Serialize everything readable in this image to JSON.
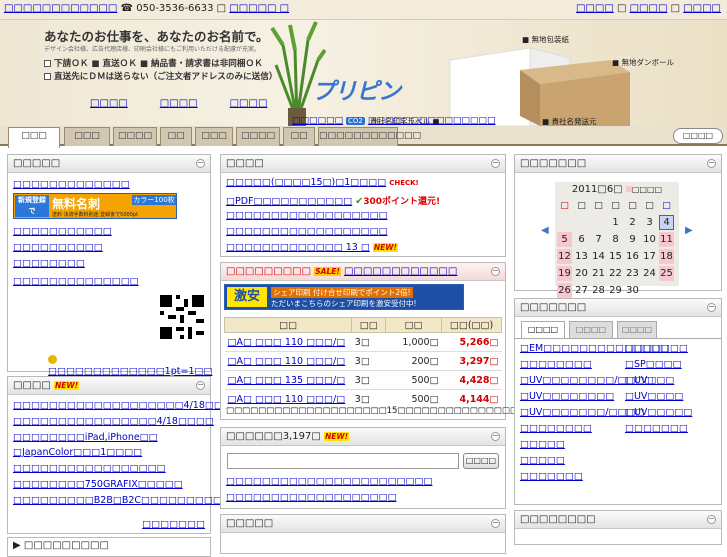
{
  "topbar": {
    "left_text": "□□□□□□□□□□□□",
    "phone": "050-3536-6633 □",
    "phone_suffix": "□□□□□ □",
    "right_links": [
      "□□□□",
      "□□□□",
      "□□□□"
    ]
  },
  "hero": {
    "headline": "あなたのお仕事を、あなたのお名前で。",
    "sub": "デザイン会社様、広告代理店様、印刷会社様にもご利用いただける配慮が充実。",
    "features": [
      "下請ＯＫ ■ 直送ＯＫ ■ 納品書・請求書は非同梱ＯＫ",
      "直送先にＤＭは送らない（ご注文者アドレスのみに送信）"
    ],
    "links": [
      "□□□□",
      "□□□□",
      "□□□□"
    ],
    "logo": "プリピン",
    "eco_left": "□□□□□□",
    "eco_badge": "CO2",
    "eco_right": "□□□□□□□□□□□□□□□",
    "labels": [
      "無地包装紙",
      "無地ダンボール",
      "貴社名印字ラベル",
      "貴社名発送元"
    ]
  },
  "tabs": [
    "□□□",
    "□□□",
    "□□□□",
    "□□",
    "□□□",
    "□□□□",
    "□□",
    "□□□□□□□□□□□□"
  ],
  "search_tab": "□□□□",
  "left1": {
    "title": "□□□□□",
    "items": [
      "□□□□□□□□□□□□□",
      "□□□□□□□□□□□",
      "□□□□□□□□□□",
      "□□□□□□□□",
      "□□□□□□□□□□□□□□"
    ],
    "banner_left": "新規登録で",
    "banner_mid": "無料名刺",
    "banner_right": "カラー100枚",
    "banner_sub": "送料 決済手数料別途 登録後で5000pt",
    "footer": "□□□□□□□□□□□□□1pt=1□□"
  },
  "left2": {
    "title": "□□□□",
    "items": [
      "□□□□□□□□□□□□□□□□□□□4/18□□□",
      "□□□□□□□□□□□□□□□□4/18□□□□",
      "□□□□□□□□iPad,iPhone□□",
      "□JapanColor□□□1□□□□",
      "□□□□□□□□□□□□□□□□□",
      "□□□□□□□□750GRAFIX□□□□□",
      "□□□□□□□□□B2B□B2C□□□□□□□□□□"
    ],
    "more": "□□□□□□□",
    "new": "NEW!"
  },
  "left3": {
    "title": "□□□□□□□□□"
  },
  "mid1": {
    "title": "□□□□",
    "items": [
      "□□□□□(□□□□15□)□1□□□□",
      "□PDF□□□□□□□□□□□",
      "□□□□□□□□□□□□□□□□□□",
      "□□□□□□□□□□□□□□□□□□",
      "□□□□□□□□□□□□□ 13 □"
    ],
    "check": "CHECK!",
    "points": "300ポイント還元!",
    "new": "NEW!"
  },
  "mid2": {
    "title_left": "□□□□□□□□□",
    "sale": "SALE!",
    "title_right": "□□□□□□□□□□□□",
    "banner_big": "激安",
    "banner_line1": "シェア印刷 付け合せ印刷でポイント2倍!",
    "banner_line2": "ただいまこちらのシェア印刷を激安受付中!",
    "headers": [
      "□□",
      "□□",
      "□□",
      "□□(□□)"
    ],
    "rows": [
      [
        "□A□ □□□ 110 □□□/□",
        "3□",
        "1,000□",
        "5,266□"
      ],
      [
        "□A□ □□□ 110 □□□/□",
        "3□",
        "200□",
        "3,297□"
      ],
      [
        "□A□ □□□ 135 □□□/□",
        "3□",
        "500□",
        "4,428□"
      ],
      [
        "□A□ □□□ 110 □□□/□",
        "3□",
        "500□",
        "4,144□"
      ]
    ],
    "footnote": "□□□□□□□□□□□□□□□□□□□□15□□□□□□□□□□□□□□□"
  },
  "mid3": {
    "title": "□□□□□□3,197□",
    "new": "NEW!",
    "search_button": "□□□□",
    "links": [
      "□□□□□□□□□□□□□□□□□□□□□□□",
      "□□□□□□□□□□□□□□□□□□□"
    ]
  },
  "mid4": {
    "title": "□□□□□"
  },
  "cal": {
    "title": "□□□□□□□",
    "header": "2011□6□",
    "legend": "□□□□",
    "weekdays": [
      "□",
      "□",
      "□",
      "□",
      "□",
      "□",
      "□"
    ],
    "weeks": [
      [
        "",
        "",
        "",
        "1",
        "2",
        "3",
        "4"
      ],
      [
        "5",
        "6",
        "7",
        "8",
        "9",
        "10",
        "11"
      ],
      [
        "12",
        "13",
        "14",
        "15",
        "16",
        "17",
        "18"
      ],
      [
        "19",
        "20",
        "21",
        "22",
        "23",
        "24",
        "25"
      ],
      [
        "26",
        "27",
        "28",
        "29",
        "30",
        "",
        ""
      ]
    ]
  },
  "right2": {
    "title": "□□□□□□□",
    "subtabs": [
      "□□□□",
      "□□□□",
      "□□□□"
    ],
    "left_items": [
      "□EM□□□□□□□□□□□□□□",
      "□□□□□□□□",
      "□UV□□□□□□□□/□□□□",
      "□UV□□□□□□□□",
      "□UV□□□□□□□/□□□□",
      "□□□□□□□□",
      "□□□□□",
      "□□□□□",
      "□□□□□□□"
    ],
    "right_items": [
      "□□□□□□□",
      "□SP□□□□",
      "□UV□□□",
      "□UV□□□□",
      "□UV□□□□□",
      "□□□□□□□"
    ]
  },
  "right3": {
    "title": "□□□□□□□□"
  }
}
